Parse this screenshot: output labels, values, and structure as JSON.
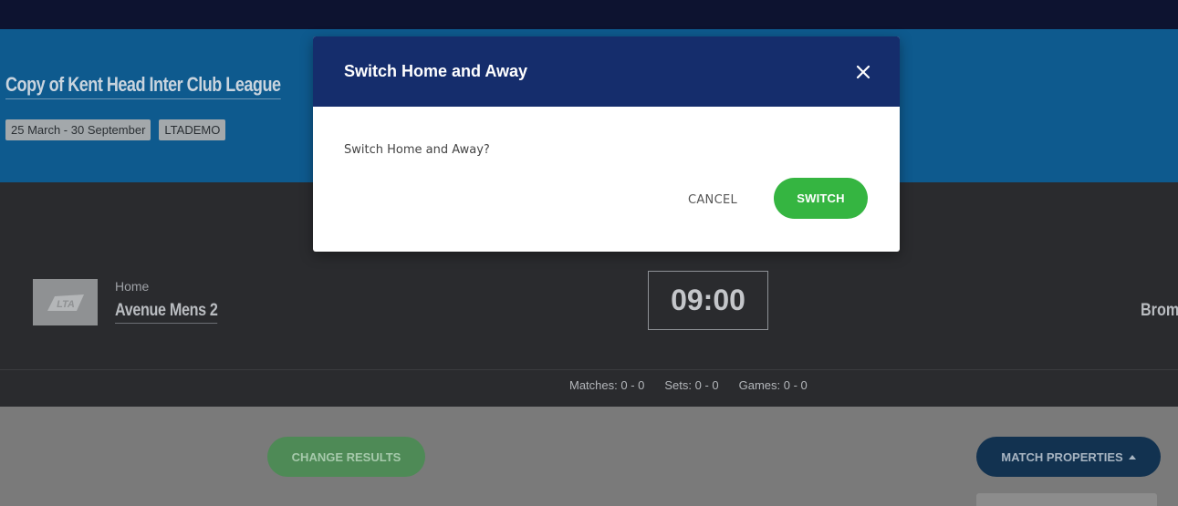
{
  "event": {
    "title": "Copy of Kent Head Inter Club League",
    "tags": [
      "25 March - 30 September",
      "LTADEMO"
    ]
  },
  "match": {
    "home_label": "Home",
    "home_team": "Avenue Mens 2",
    "home_logo_text": "LTA",
    "time": "09:00",
    "away_team_partial": "Brom"
  },
  "stats": {
    "matches": "Matches: 0 - 0",
    "sets": "Sets: 0 - 0",
    "games": "Games: 0 - 0"
  },
  "actions": {
    "change_results": "CHANGE RESULTS",
    "match_properties": "MATCH PROPERTIES"
  },
  "modal": {
    "title": "Switch Home and Away",
    "message": "Switch Home and Away?",
    "cancel_label": "CANCEL",
    "confirm_label": "SWITCH",
    "close_icon": "close-icon"
  },
  "colors": {
    "modal_header": "#152d6c",
    "confirm_button": "#35b541",
    "overlay": "rgba(0,0,0,0.5)"
  }
}
